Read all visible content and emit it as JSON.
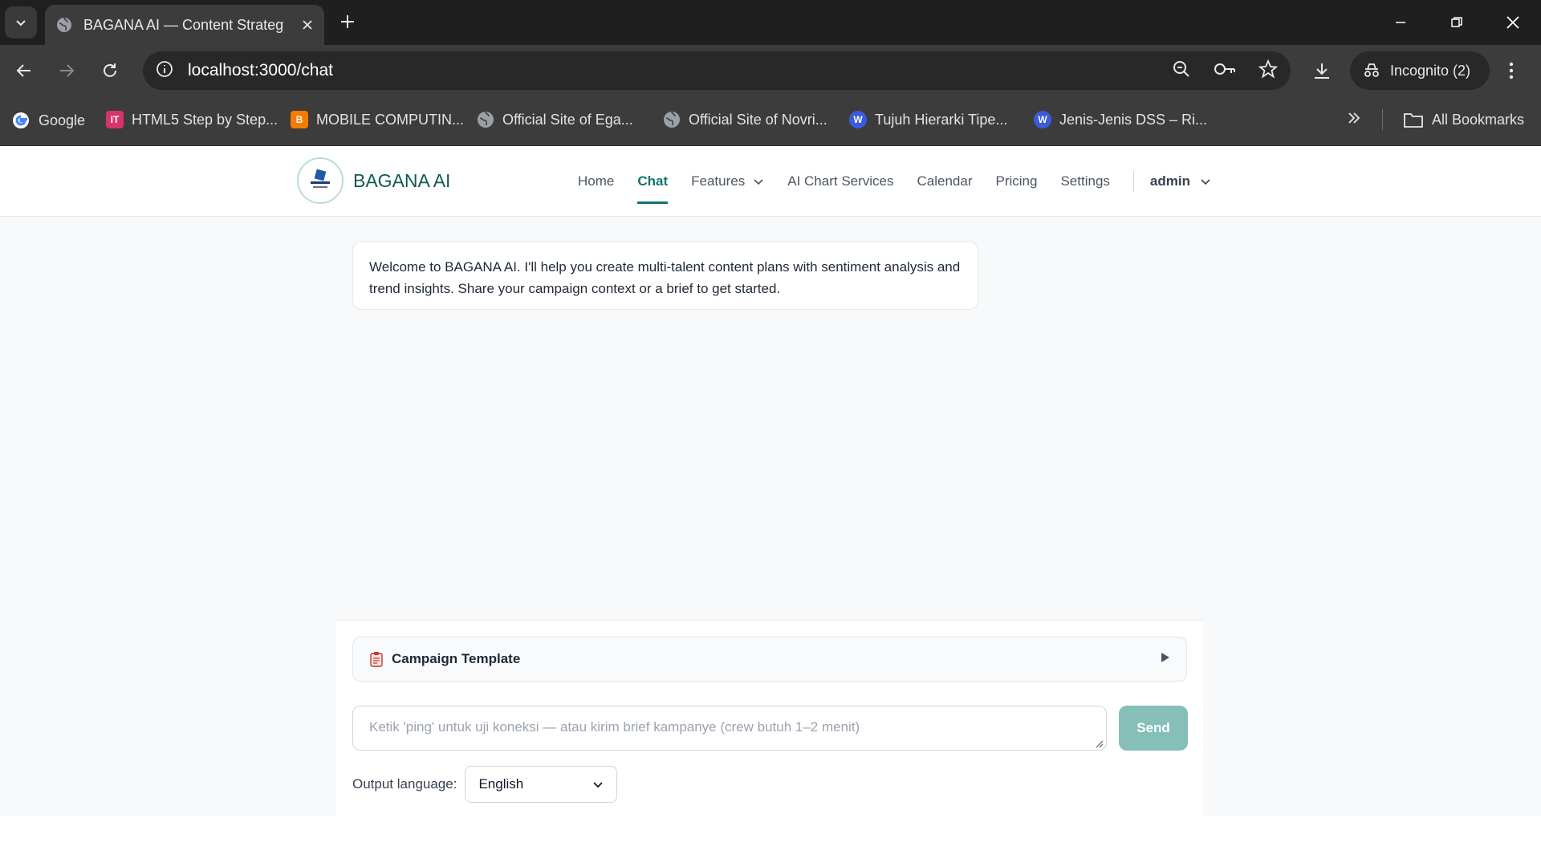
{
  "browser": {
    "tab_title": "BAGANA AI — Content Strategy",
    "url_host": "localhost",
    "url_rest": ":3000/chat",
    "incognito_label": "Incognito (2)",
    "bookmarks": [
      {
        "label": "Google",
        "icon": "google-icon"
      },
      {
        "label": "HTML5 Step by Step...",
        "icon": "it-icon",
        "color": "#d6336c"
      },
      {
        "label": "MOBILE COMPUTIN...",
        "icon": "blogger-icon",
        "color": "#f57c00"
      },
      {
        "label": "Official Site of Ega...",
        "icon": "globe-icon"
      },
      {
        "label": "Official Site of Novri...",
        "icon": "globe-icon"
      },
      {
        "label": "Tujuh Hierarki Tipe...",
        "icon": "wordpress-icon",
        "color": "#3b5bdb"
      },
      {
        "label": "Jenis-Jenis DSS – Ri...",
        "icon": "wordpress-icon",
        "color": "#3b5bdb"
      }
    ],
    "all_bookmarks_label": "All Bookmarks"
  },
  "app": {
    "brand": "BAGANA AI",
    "nav": {
      "home": "Home",
      "chat": "Chat",
      "features": "Features",
      "ai_chart": "AI Chart Services",
      "calendar": "Calendar",
      "pricing": "Pricing",
      "settings": "Settings",
      "user": "admin"
    },
    "welcome_message": "Welcome to BAGANA AI. I'll help you create multi-talent content plans with sentiment analysis and trend insights. Share your campaign context or a brief to get started.",
    "template_label": "Campaign Template",
    "input_placeholder": "Ketik 'ping' untuk uji koneksi — atau kirim brief kampanye (crew butuh 1–2 menit)",
    "send_label": "Send",
    "output_language_label": "Output language:",
    "output_language_value": "English",
    "accent_color": "#0f766e"
  }
}
